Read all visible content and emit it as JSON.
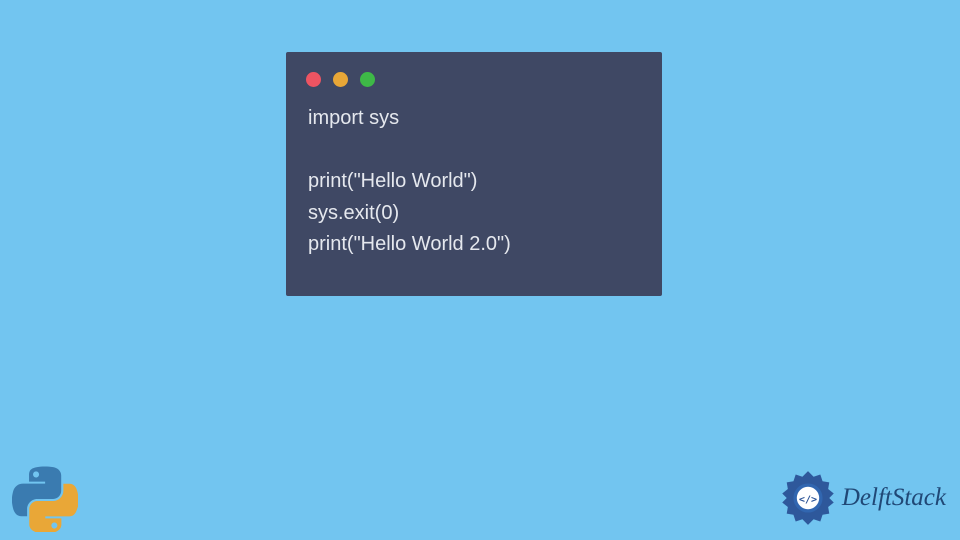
{
  "window": {
    "traffic_lights": {
      "red": "#ed5462",
      "yellow": "#e9a737",
      "green": "#3eb947"
    },
    "background": "#3f4864"
  },
  "code": {
    "line1": "import sys",
    "line2": "",
    "line3": "print(\"Hello World\")",
    "line4": "sys.exit(0)",
    "line5": "print(\"Hello World 2.0\")"
  },
  "branding": {
    "site_name": "DelftStack"
  },
  "colors": {
    "page_background": "#72c5f0",
    "code_text": "#e5e8ee",
    "brand_text": "#204876"
  }
}
